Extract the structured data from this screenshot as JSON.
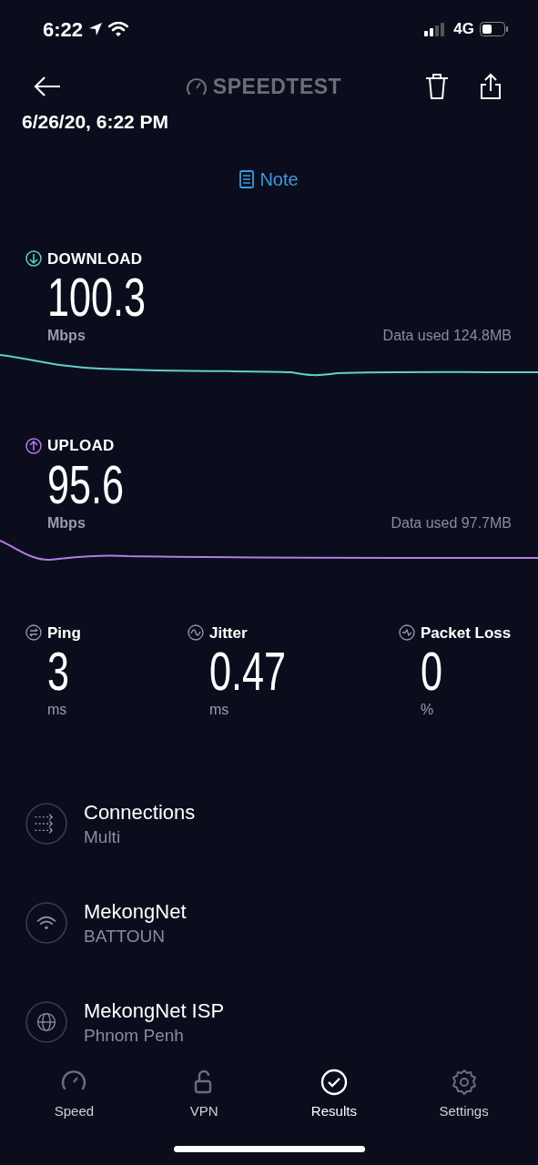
{
  "status_bar": {
    "time": "6:22",
    "network": "4G"
  },
  "header": {
    "logo_text": "SPEEDTEST",
    "date": "6/26/20, 6:22 PM",
    "note_link": "Note"
  },
  "speeds": [
    {
      "kind": "download",
      "label": "DOWNLOAD",
      "value": "100.3",
      "unit": "Mbps",
      "data_used": "Data used 124.8MB",
      "color": "#5fd0cc"
    },
    {
      "kind": "upload",
      "label": "UPLOAD",
      "value": "95.6",
      "unit": "Mbps",
      "data_used": "Data used 97.7MB",
      "color": "#b57bea"
    }
  ],
  "metrics": [
    {
      "kind": "ping",
      "label": "Ping",
      "value": "3",
      "unit": "ms"
    },
    {
      "kind": "jitter",
      "label": "Jitter",
      "value": "0.47",
      "unit": "ms"
    },
    {
      "kind": "packet_loss",
      "label": "Packet Loss",
      "value": "0",
      "unit": "%"
    }
  ],
  "details": [
    {
      "kind": "connections",
      "title": "Connections",
      "subtitle": "Multi"
    },
    {
      "kind": "network",
      "title": "MekongNet",
      "subtitle": "BATTOUN"
    },
    {
      "kind": "isp",
      "title": "MekongNet ISP",
      "subtitle": "Phnom Penh"
    }
  ],
  "tabs": [
    {
      "kind": "speed",
      "label": "Speed",
      "selected": false
    },
    {
      "kind": "vpn",
      "label": "VPN",
      "selected": false
    },
    {
      "kind": "results",
      "label": "Results",
      "selected": true
    },
    {
      "kind": "settings",
      "label": "Settings",
      "selected": false
    }
  ]
}
